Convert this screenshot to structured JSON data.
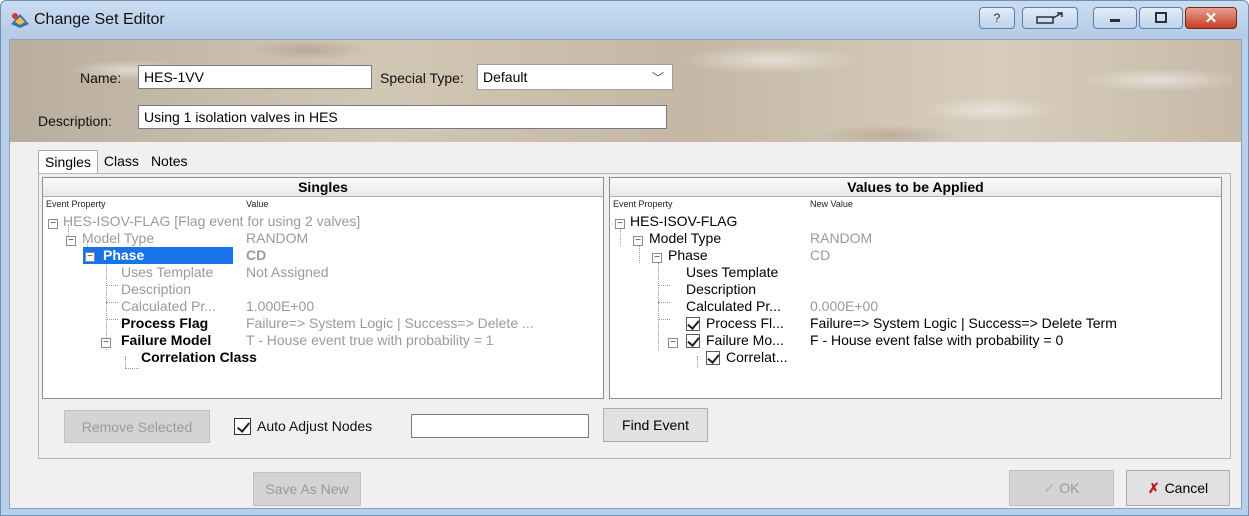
{
  "window": {
    "title": "Change Set Editor",
    "help_label": "?",
    "close_label": "✕"
  },
  "header": {
    "name_label": "Name:",
    "name_value": "HES-1VV",
    "special_type_label": "Special Type:",
    "special_type_value": "Default",
    "description_label": "Description:",
    "description_value": "Using 1 isolation valves in HES"
  },
  "tabs": [
    "Singles",
    "Class",
    "Notes"
  ],
  "singles": {
    "title": "Singles",
    "col_property": "Event Property",
    "col_value": "Value",
    "rows": [
      {
        "label": "HES-ISOV-FLAG  [Flag event for using 2 valves]",
        "value": ""
      },
      {
        "label": "Model Type",
        "value": "RANDOM"
      },
      {
        "label": "Phase",
        "value": "CD"
      },
      {
        "label": "Uses Template",
        "value": "Not Assigned"
      },
      {
        "label": "Description",
        "value": ""
      },
      {
        "label": "Calculated Pr...",
        "value": "1.000E+00"
      },
      {
        "label": "Process Flag",
        "value": "Failure=> System Logic     | Success=> Delete ..."
      },
      {
        "label": "Failure Model",
        "value": "T - House event true with probability = 1"
      },
      {
        "label": "Correlation Class",
        "value": ""
      }
    ]
  },
  "applied": {
    "title": "Values to be Applied",
    "col_property": "Event Property",
    "col_value": "New Value",
    "rows": [
      {
        "label": "HES-ISOV-FLAG",
        "value": ""
      },
      {
        "label": "Model Type",
        "value": "RANDOM"
      },
      {
        "label": "Phase",
        "value": "CD"
      },
      {
        "label": "Uses Template",
        "value": ""
      },
      {
        "label": "Description",
        "value": ""
      },
      {
        "label": "Calculated Pr...",
        "value": "0.000E+00"
      },
      {
        "label": "Process Fl...",
        "value": "Failure=> System Logic     | Success=> Delete Term"
      },
      {
        "label": "Failure Mo...",
        "value": "F - House event false with probability = 0"
      },
      {
        "label": "Correlat...",
        "value": ""
      }
    ]
  },
  "bottom": {
    "remove_selected": "Remove Selected",
    "auto_adjust": "Auto Adjust Nodes",
    "find_input": "",
    "find_event": "Find Event"
  },
  "footer": {
    "save_as_new": "Save As New",
    "ok": "OK",
    "cancel": "Cancel"
  },
  "colors": {
    "selection": "#1873e6",
    "cancel_icon": "#c0161a"
  }
}
